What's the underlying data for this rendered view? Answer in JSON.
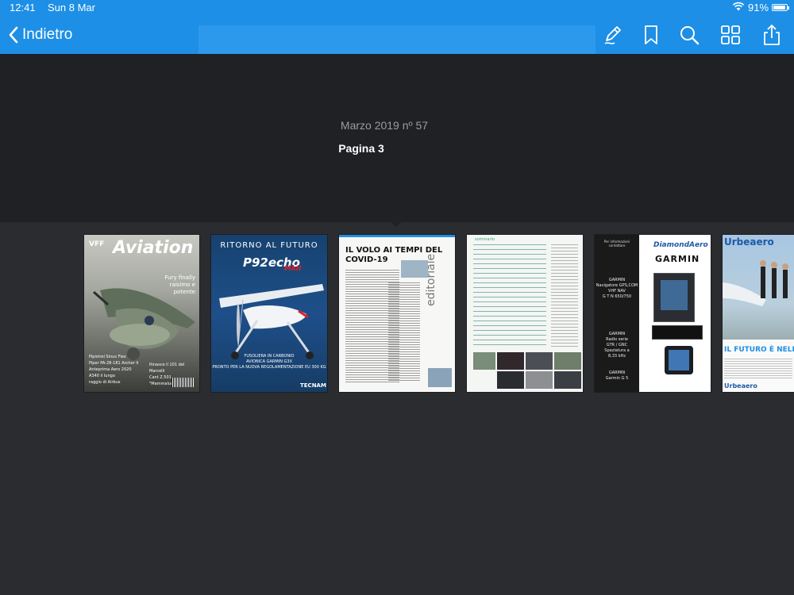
{
  "status": {
    "time": "12:41",
    "date": "Sun 8 Mar",
    "battery": "91%",
    "battery_level": 0.91
  },
  "nav": {
    "back_label": "Indietro"
  },
  "toolbar": {
    "icons": [
      "annotate-pen-icon",
      "bookmark-icon",
      "search-icon",
      "grid-view-icon",
      "share-icon"
    ]
  },
  "header": {
    "issue": "Marzo 2019 nº 57",
    "page": "Pagina 3"
  },
  "thumbnails": [
    {
      "logo_prefix": "VFF",
      "brand": "Aviation",
      "tagline": "Fury finally raisimo e potente",
      "lines": [
        "Pipistrel Sinus Flex",
        "Piper PA-28-181 Archer II",
        "Anteprima Aero 2020",
        "A340 il lungo raggio di Airbus"
      ],
      "side": [
        "Rinasce il 101 del Marcelli",
        "Cant Z.501 \"Mammaluco\""
      ]
    },
    {
      "title": "RITORNO AL FUTURO",
      "logo": "P92echo",
      "logo_sub": "MkII",
      "desc1": "FUSOLIERA IN CARBONIO",
      "desc2": "AVIONICA GARMIN G3X",
      "desc3": "PRONTO PER LA NUOVA REGOLAMENTAZIONE EU 300 KG",
      "footer": "TECNAM"
    },
    {
      "headline_1": "IL VOLO AI TEMPI DEL",
      "headline_2": "COVID-19",
      "section": "editoriale"
    },
    {
      "section": "sommario"
    },
    {
      "info": "Per informazioni contattare",
      "brand_top": "DiamondAero",
      "brand_main": "GARMIN",
      "items": [
        "GARMIN",
        "Navigatore GPS,COM",
        "VHF NAV",
        "G T N 650/750",
        "GARMIN",
        "Radio serie",
        "GTR / GNC",
        "Spaziatura a",
        "8,33 kHz",
        "GARMIN",
        "Garmin G 5"
      ]
    },
    {
      "brand": "Urbeaero",
      "headline": "IL FUTURO È NELLE",
      "footer_brand": "Urbeaero"
    }
  ],
  "colors": {
    "topbar": "#1d8fe6",
    "header": "#1f2124",
    "background": "#2a2c30",
    "tecnam_blue": "#1e4f8a"
  }
}
